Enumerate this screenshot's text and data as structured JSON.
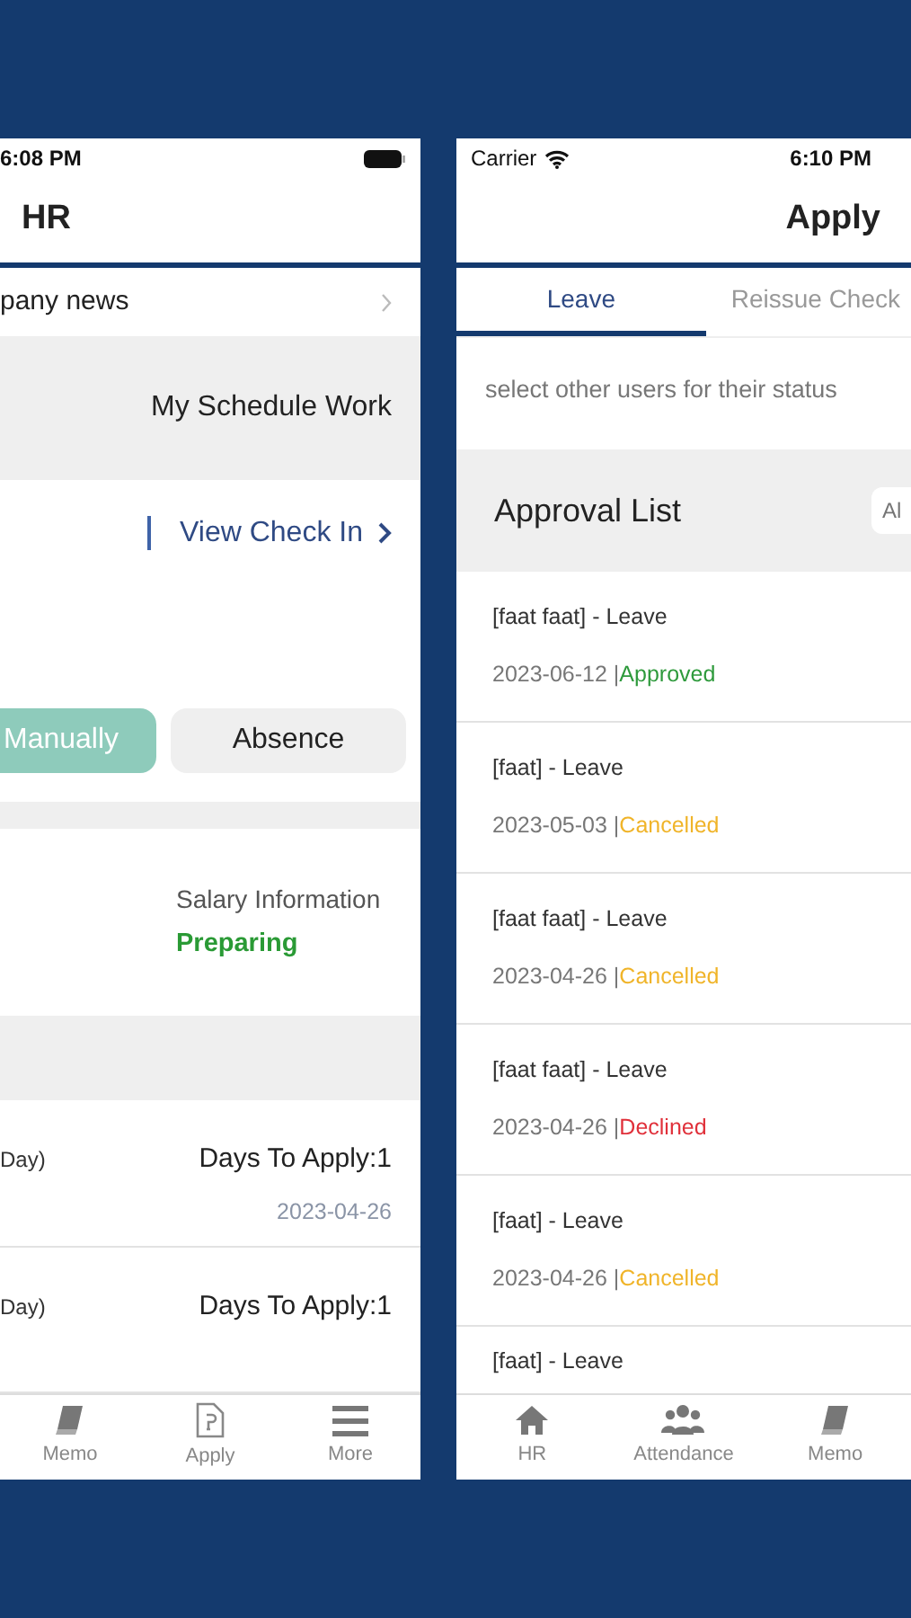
{
  "left_screen": {
    "status_bar": {
      "time": "6:08 PM"
    },
    "title": "HR",
    "news_row": {
      "label": "pany news"
    },
    "schedule_label": "My Schedule Work",
    "check_in_link": "View Check In",
    "buttons": [
      {
        "label": "Manually",
        "kind": "primary"
      },
      {
        "label": "Absence",
        "kind": "secondary"
      }
    ],
    "salary": {
      "label": "Salary Information",
      "status": "Preparing"
    },
    "leave_rows": [
      {
        "label": "Day)",
        "days": "Days To Apply:1",
        "date": "2023-04-26"
      },
      {
        "label": "Day)",
        "days": "Days To Apply:1"
      }
    ],
    "tab_bar": [
      {
        "label": "Memo",
        "kind": "book"
      },
      {
        "label": "Apply",
        "kind": "document"
      },
      {
        "label": "More",
        "kind": "menu"
      }
    ]
  },
  "right_screen": {
    "status_bar": {
      "carrier": "Carrier",
      "time": "6:10 PM"
    },
    "title": "Apply",
    "tabs": [
      {
        "label": "Leave",
        "selected": true
      },
      {
        "label": "Reissue Check",
        "selected": false
      }
    ],
    "hint": "select other users for their status",
    "approval": {
      "title": "Approval List",
      "filter_placeholder": "Al"
    },
    "items": [
      {
        "title": "[faat faat] - Leave",
        "date": "2023-06-12 |",
        "status": "Approved",
        "color": "#2e9a3c"
      },
      {
        "title": "[faat] - Leave",
        "date": "2023-05-03 |",
        "status": "Cancelled",
        "color": "#f0b429"
      },
      {
        "title": "[faat faat] - Leave",
        "date": "2023-04-26 |",
        "status": "Cancelled",
        "color": "#f0b429"
      },
      {
        "title": "[faat faat] - Leave",
        "date": "2023-04-26 |",
        "status": "Declined",
        "color": "#e0303a"
      },
      {
        "title": "[faat] - Leave",
        "date": "2023-04-26 |",
        "status": "Cancelled",
        "color": "#f0b429"
      },
      {
        "title": "[faat] - Leave"
      }
    ],
    "tab_bar": [
      {
        "label": "HR",
        "kind": "home"
      },
      {
        "label": "Attendance",
        "kind": "people"
      },
      {
        "label": "Memo",
        "kind": "book"
      }
    ]
  }
}
